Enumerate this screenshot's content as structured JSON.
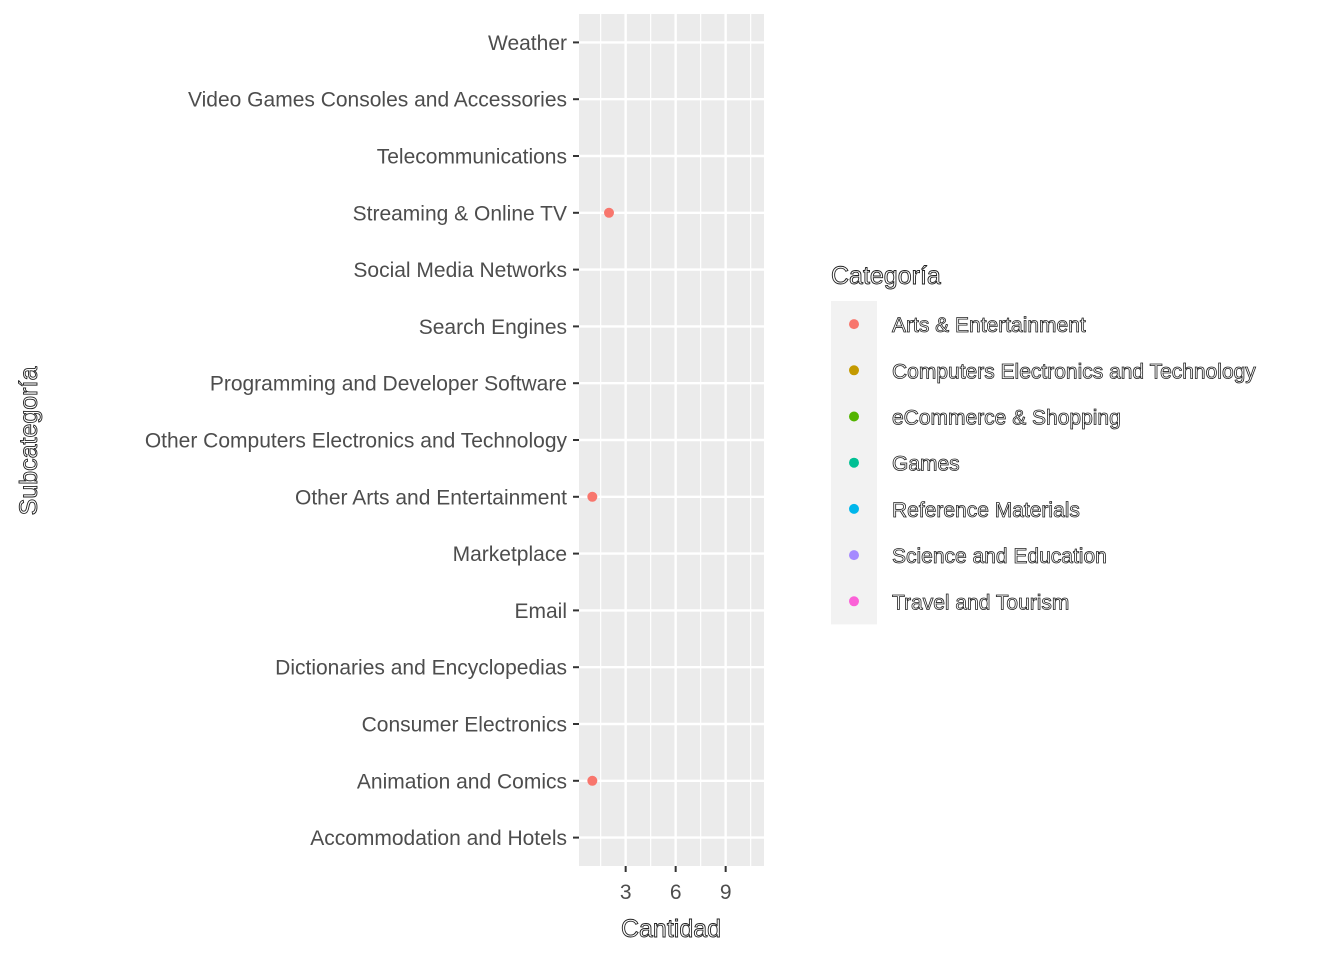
{
  "chart_data": {
    "type": "scatter",
    "xlabel": "Cantidad",
    "ylabel": "Subcategoría",
    "xlim": [
      0.2,
      11.3
    ],
    "x_ticks": [
      3,
      6,
      9
    ],
    "x_minor": [
      1.5,
      4.5,
      7.5,
      10.5
    ],
    "grid": true,
    "categories": [
      "Accommodation and Hotels",
      "Animation and Comics",
      "Consumer Electronics",
      "Dictionaries and Encyclopedias",
      "Email",
      "Marketplace",
      "Other Arts and Entertainment",
      "Other Computers Electronics and Technology",
      "Programming and Developer Software",
      "Search Engines",
      "Social Media Networks",
      "Streaming & Online TV",
      "Telecommunications",
      "Video Games Consoles and Accessories",
      "Weather"
    ],
    "points": [
      {
        "y": "Streaming & Online TV",
        "x": 2,
        "series": "Arts & Entertainment"
      },
      {
        "y": "Other Arts and Entertainment",
        "x": 1,
        "series": "Arts & Entertainment"
      },
      {
        "y": "Animation and Comics",
        "x": 1,
        "series": "Arts & Entertainment"
      }
    ],
    "legend": {
      "title": "Categoría",
      "position": "right",
      "items": [
        {
          "label": "Arts & Entertainment",
          "color": "#F8766D"
        },
        {
          "label": "Computers Electronics and Technology",
          "color": "#C49A00"
        },
        {
          "label": "eCommerce & Shopping",
          "color": "#53B400"
        },
        {
          "label": "Games",
          "color": "#00C094"
        },
        {
          "label": "Reference Materials",
          "color": "#00B6EB"
        },
        {
          "label": "Science and Education",
          "color": "#A58AFF"
        },
        {
          "label": "Travel and Tourism",
          "color": "#FB61D7"
        }
      ]
    },
    "panel_color": "#EBEBEB",
    "grid_color": "#FFFFFF"
  }
}
